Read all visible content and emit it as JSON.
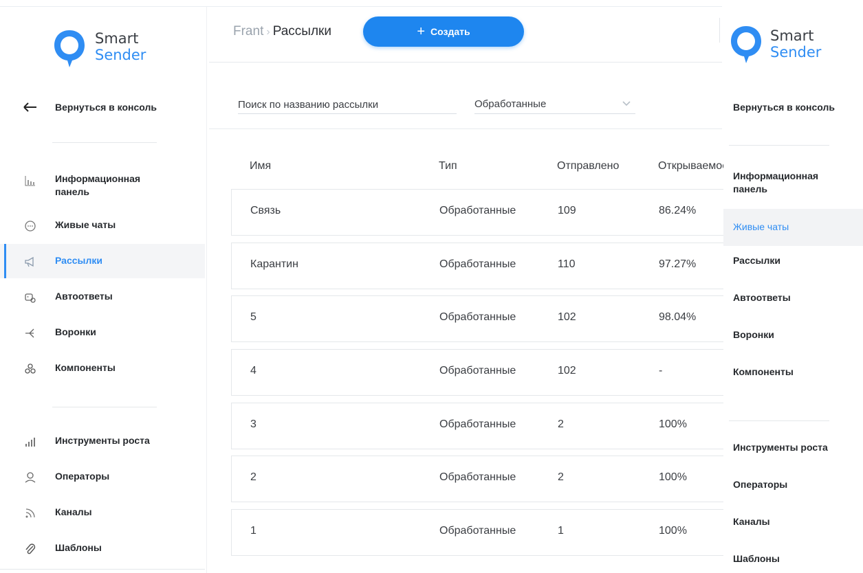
{
  "brand": {
    "line1": "Smart",
    "line2": "Sender",
    "accent": "#2f8df3"
  },
  "sidebar": {
    "back_label": "Вернуться в консоль",
    "items": [
      {
        "label": "Информационная панель",
        "icon": "chart-icon"
      },
      {
        "label": "Живые чаты",
        "icon": "chat-bubble-icon"
      },
      {
        "label": "Рассылки",
        "icon": "megaphone-icon"
      },
      {
        "label": "Автоответы",
        "icon": "robot-icon"
      },
      {
        "label": "Воронки",
        "icon": "funnel-flow-icon"
      },
      {
        "label": "Компоненты",
        "icon": "components-icon"
      },
      {
        "label": "Инструменты роста",
        "icon": "growth-bars-icon"
      },
      {
        "label": "Операторы",
        "icon": "operator-icon"
      },
      {
        "label": "Каналы",
        "icon": "rss-icon"
      },
      {
        "label": "Шаблоны",
        "icon": "paperclip-icon"
      }
    ],
    "active_index": 2
  },
  "header": {
    "breadcrumb_root": "Frant",
    "breadcrumb_current": "Рассылки",
    "create_label": "Создать"
  },
  "filters": {
    "search_placeholder": "Поиск по названию рассылки",
    "status_value": "Обработанные"
  },
  "table": {
    "columns": [
      "Имя",
      "Тип",
      "Отправлено",
      "Открываемость"
    ],
    "rows": [
      {
        "name": "Связь",
        "type": "Обработанные",
        "sent": "109",
        "open_rate": "86.24%"
      },
      {
        "name": "Карантин",
        "type": "Обработанные",
        "sent": "110",
        "open_rate": "97.27%"
      },
      {
        "name": "5",
        "type": "Обработанные",
        "sent": "102",
        "open_rate": "98.04%"
      },
      {
        "name": "4",
        "type": "Обработанные",
        "sent": "102",
        "open_rate": "-"
      },
      {
        "name": "3",
        "type": "Обработанные",
        "sent": "2",
        "open_rate": "100%"
      },
      {
        "name": "2",
        "type": "Обработанные",
        "sent": "2",
        "open_rate": "100%"
      },
      {
        "name": "1",
        "type": "Обработанные",
        "sent": "1",
        "open_rate": "100%"
      }
    ]
  },
  "right_panel": {
    "back_label": "Вернуться в консоль",
    "items": [
      {
        "label": "Информационная панель"
      },
      {
        "label": "Живые чаты"
      },
      {
        "label": "Рассылки"
      },
      {
        "label": "Автоответы"
      },
      {
        "label": "Воронки"
      },
      {
        "label": "Компоненты"
      },
      {
        "label": "Инструменты роста"
      },
      {
        "label": "Операторы"
      },
      {
        "label": "Каналы"
      },
      {
        "label": "Шаблоны"
      }
    ],
    "highlighted_index": 1
  }
}
